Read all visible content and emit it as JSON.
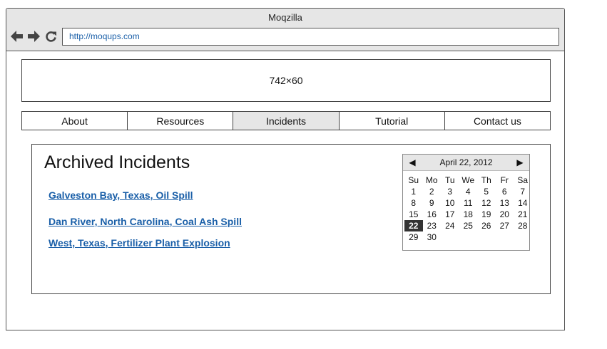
{
  "browser": {
    "title": "Moqzilla",
    "url": "http://moqups.com"
  },
  "banner": {
    "text": "742×60"
  },
  "nav": {
    "tabs": [
      {
        "label": "About"
      },
      {
        "label": "Resources"
      },
      {
        "label": "Incidents"
      },
      {
        "label": "Tutorial"
      },
      {
        "label": "Contact us"
      }
    ],
    "active": "Incidents"
  },
  "main": {
    "heading": "Archived Incidents",
    "links": [
      {
        "label": "Galveston Bay, Texas, Oil Spill"
      },
      {
        "label": "Dan River, North Carolina, Coal Ash Spill"
      },
      {
        "label": "West, Texas, Fertilizer Plant Explosion"
      }
    ]
  },
  "calendar": {
    "month_label": "April 22, 2012",
    "prev_glyph": "◀",
    "next_glyph": "▶",
    "weekdays": [
      "Su",
      "Mo",
      "Tu",
      "We",
      "Th",
      "Fr",
      "Sa"
    ],
    "days": [
      "1",
      "2",
      "3",
      "4",
      "5",
      "6",
      "7",
      "8",
      "9",
      "10",
      "11",
      "12",
      "13",
      "14",
      "15",
      "16",
      "17",
      "18",
      "19",
      "20",
      "21",
      "22",
      "23",
      "24",
      "25",
      "26",
      "27",
      "28",
      "29",
      "30"
    ],
    "selected_day": "22"
  },
  "colors": {
    "link": "#1a5fa8",
    "chrome": "#e6e6e6",
    "selected": "#333333"
  },
  "icons": [
    "back-arrow-icon",
    "forward-arrow-icon",
    "reload-icon"
  ]
}
